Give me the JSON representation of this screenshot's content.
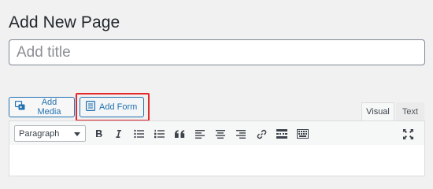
{
  "page": {
    "title": "Add New Page"
  },
  "title_field": {
    "placeholder": "Add title",
    "value": ""
  },
  "media_buttons": {
    "add_media": "Add Media",
    "add_form": "Add Form"
  },
  "editor_tabs": {
    "visual": "Visual",
    "text": "Text",
    "active": "Visual"
  },
  "toolbar": {
    "format_select": "Paragraph",
    "buttons": [
      "bold",
      "italic",
      "bulleted-list",
      "numbered-list",
      "blockquote",
      "align-left",
      "align-center",
      "align-right",
      "insert-link",
      "read-more",
      "toolbar-toggle",
      "fullscreen"
    ]
  },
  "colors": {
    "accent": "#2271b1",
    "highlight": "#e0282e",
    "background": "#f1f1f1"
  }
}
